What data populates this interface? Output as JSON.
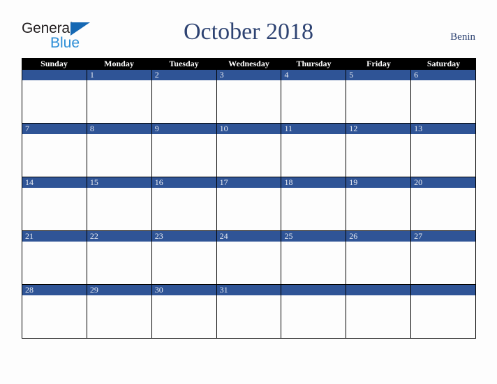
{
  "brand": {
    "name_top": "General",
    "name_bottom": "Blue",
    "color_dark": "#231f20",
    "color_blue": "#2c8dd6",
    "triangle_color": "#1668b3"
  },
  "header": {
    "title": "October 2018",
    "region": "Benin",
    "title_color": "#2e4372"
  },
  "colors": {
    "weekday_header_bg": "#000000",
    "weekday_header_text": "#ffffff",
    "date_bar_bg": "#2f5496",
    "date_text": "#e8ebf2",
    "grid_line": "#000000",
    "cell_bg": "#fdfdfd",
    "page_bg": "#fdfdfd"
  },
  "weekdays": [
    "Sunday",
    "Monday",
    "Tuesday",
    "Wednesday",
    "Thursday",
    "Friday",
    "Saturday"
  ],
  "weeks": [
    [
      {
        "day": ""
      },
      {
        "day": "1"
      },
      {
        "day": "2"
      },
      {
        "day": "3"
      },
      {
        "day": "4"
      },
      {
        "day": "5"
      },
      {
        "day": "6"
      }
    ],
    [
      {
        "day": "7"
      },
      {
        "day": "8"
      },
      {
        "day": "9"
      },
      {
        "day": "10"
      },
      {
        "day": "11"
      },
      {
        "day": "12"
      },
      {
        "day": "13"
      }
    ],
    [
      {
        "day": "14"
      },
      {
        "day": "15"
      },
      {
        "day": "16"
      },
      {
        "day": "17"
      },
      {
        "day": "18"
      },
      {
        "day": "19"
      },
      {
        "day": "20"
      }
    ],
    [
      {
        "day": "21"
      },
      {
        "day": "22"
      },
      {
        "day": "23"
      },
      {
        "day": "24"
      },
      {
        "day": "25"
      },
      {
        "day": "26"
      },
      {
        "day": "27"
      }
    ],
    [
      {
        "day": "28"
      },
      {
        "day": "29"
      },
      {
        "day": "30"
      },
      {
        "day": "31"
      },
      {
        "day": ""
      },
      {
        "day": ""
      },
      {
        "day": ""
      }
    ]
  ]
}
